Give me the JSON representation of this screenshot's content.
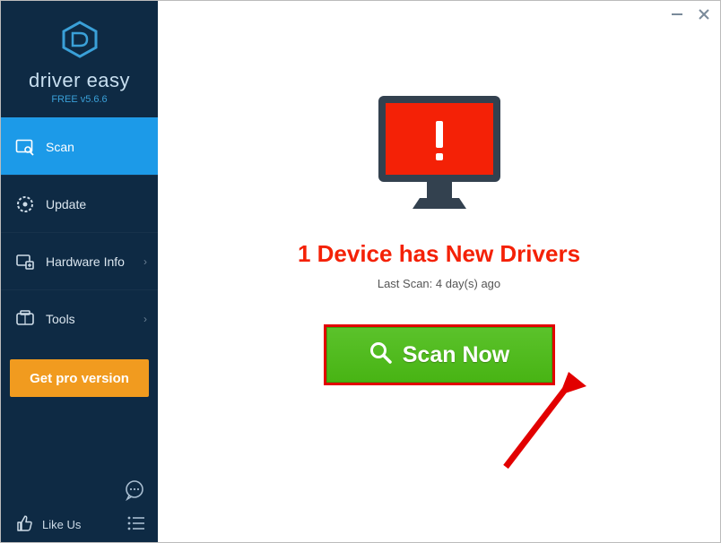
{
  "brand": {
    "name": "driver easy",
    "version": "FREE v5.6.6"
  },
  "sidebar": {
    "items": [
      {
        "label": "Scan"
      },
      {
        "label": "Update"
      },
      {
        "label": "Hardware Info"
      },
      {
        "label": "Tools"
      }
    ],
    "get_pro_label": "Get pro version",
    "like_us_label": "Like Us"
  },
  "main": {
    "headline": "1 Device has New Drivers",
    "last_scan": "Last Scan: 4 day(s) ago",
    "scan_button": "Scan Now"
  }
}
